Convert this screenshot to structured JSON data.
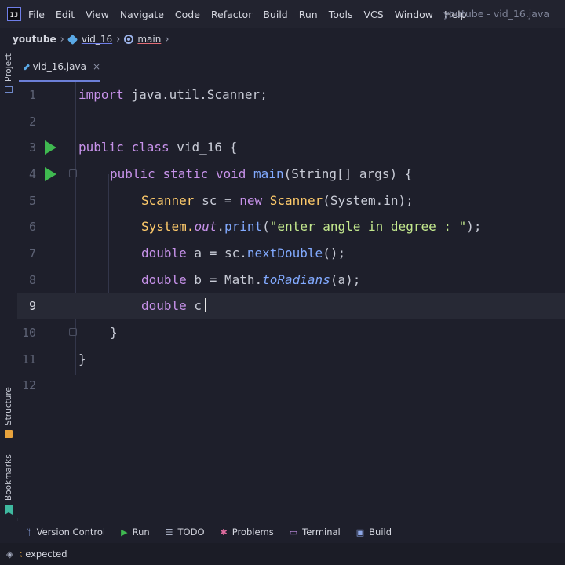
{
  "menubar": {
    "app_icon": "IJ",
    "items": [
      "File",
      "Edit",
      "View",
      "Navigate",
      "Code",
      "Refactor",
      "Build",
      "Run",
      "Tools",
      "VCS",
      "Window",
      "Help"
    ],
    "window_title": "youtube - vid_16.java"
  },
  "breadcrumb": [
    "youtube",
    "vid_16",
    "main"
  ],
  "side_tabs": {
    "project": "Project",
    "structure": "Structure",
    "bookmarks": "Bookmarks"
  },
  "tab": {
    "name": "vid_16.java",
    "close": "×"
  },
  "editor": {
    "line_numbers": [
      "1",
      "2",
      "3",
      "4",
      "5",
      "6",
      "7",
      "8",
      "9",
      "10",
      "11",
      "12"
    ],
    "lines": {
      "l1": {
        "kw": "import",
        "rest": " java.util.Scanner;"
      },
      "l3": {
        "kw1": "public",
        "kw2": "class",
        "name": "vid_16",
        "brace": " {"
      },
      "l4": {
        "kw1": "public",
        "kw2": "static",
        "kw3": "void",
        "fn": "main",
        "rest": "(String[] args) {"
      },
      "l5": {
        "cls": "Scanner",
        "var": " sc = ",
        "kw": "new",
        "cls2": " Scanner",
        "rest": "(System.in);"
      },
      "l6": {
        "a": "System.",
        "b": "out",
        "c": ".",
        "fn": "print",
        "d": "(",
        "str": "\"enter angle in degree : \"",
        "e": ");"
      },
      "l7": {
        "kw": "double",
        "rest": " a = sc.",
        "fn": "nextDouble",
        "end": "();"
      },
      "l8": {
        "kw": "double",
        "rest": " b = Math.",
        "fn": "toRadians",
        "end": "(a);"
      },
      "l9": {
        "kw": "double",
        "rest": " c"
      },
      "l10": "}",
      "l11": "}"
    }
  },
  "bottom_tools": [
    "Version Control",
    "Run",
    "TODO",
    "Problems",
    "Terminal",
    "Build"
  ],
  "status": {
    "text": "expected"
  },
  "colors": {
    "keyword": "#c792ea",
    "function": "#82aaff",
    "string": "#c3e88d",
    "run_gutter": "#3fb950"
  }
}
